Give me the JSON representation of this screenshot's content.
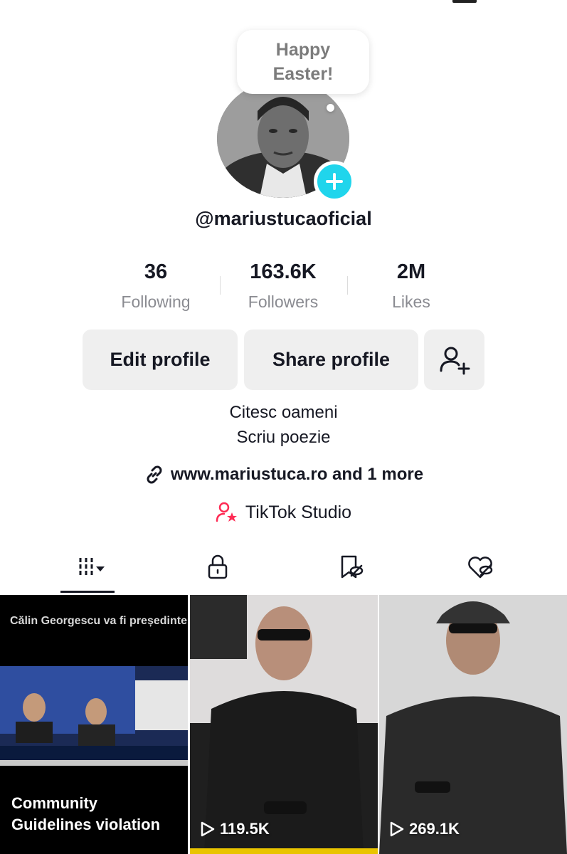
{
  "profile": {
    "bubble_line1": "Happy",
    "bubble_line2": "Easter!",
    "username": "@mariustucaoficial"
  },
  "stats": [
    {
      "value": "36",
      "label": "Following"
    },
    {
      "value": "163.6K",
      "label": "Followers"
    },
    {
      "value": "2M",
      "label": "Likes"
    }
  ],
  "actions": {
    "edit_label": "Edit profile",
    "share_label": "Share profile",
    "add_friend_icon": "add-friend-icon"
  },
  "bio": {
    "line1": "Citesc oameni",
    "line2": "Scriu poezie"
  },
  "links": {
    "label": "www.mariustuca.ro and 1 more",
    "studio": "TikTok Studio"
  },
  "tabs": [
    {
      "icon": "videos-grid-icon"
    },
    {
      "icon": "lock-icon"
    },
    {
      "icon": "favorites-hidden-icon"
    },
    {
      "icon": "liked-hidden-icon"
    }
  ],
  "videos": [
    {
      "overlay_title": "Călin Georgescu va fi președinte",
      "status_line1": "Community",
      "status_line2": "Guidelines violation"
    },
    {
      "views": "119.5K"
    },
    {
      "views": "269.1K"
    }
  ],
  "colors": {
    "accent": "#20d5ec",
    "studio_pink": "#fe2c55",
    "button_bg": "#efefef",
    "text_secondary": "#8a8b91"
  }
}
